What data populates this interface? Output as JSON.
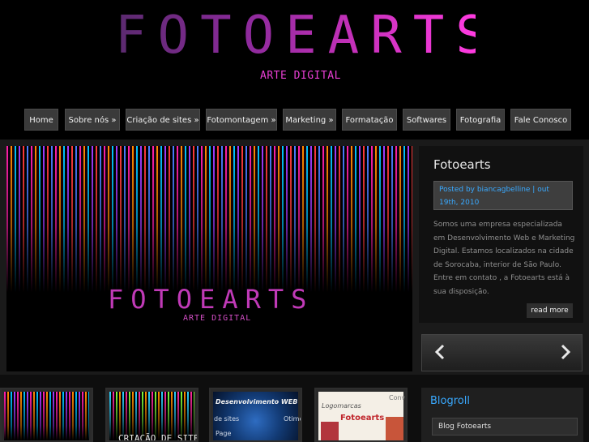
{
  "header": {
    "logo_text": "FOTOEARTS",
    "tagline": "ARTE DIGITAL"
  },
  "nav": {
    "items": [
      {
        "label": "Home"
      },
      {
        "label": "Sobre nós »"
      },
      {
        "label": "Criação de sites »"
      },
      {
        "label": "Fotomontagem »"
      },
      {
        "label": "Marketing »"
      },
      {
        "label": "Formatação"
      },
      {
        "label": "Softwares"
      },
      {
        "label": "Fotografia"
      },
      {
        "label": "Fale Conosco"
      }
    ]
  },
  "slider": {
    "logo_text": "FOTOEARTS",
    "sub_text": "ARTE DIGITAL",
    "prev_icon": "chevron-left",
    "next_icon": "chevron-right"
  },
  "post": {
    "title": "Fotoearts",
    "meta": "Posted by biancagbelline | out 19th, 2010",
    "body": "Somos uma empresa especializada em Desenvolvimento Web e Marketing Digital. Estamos localizados na cidade de Sorocaba, interior de São Paulo. Entre em contato ,  a Fotoearts está à sua disposição.",
    "read_more": "read more"
  },
  "thumbs": {
    "t2_text": "CRIAÇÃO DE SITES",
    "t3_text": "Desenvolvimento WEB",
    "t3_sub1": "de sites",
    "t3_sub2": "Page",
    "t3_sub3": "Otimo",
    "t4_text": "Logomarcas",
    "t4_logo": "Fotoearts",
    "t4_corner": "Conv"
  },
  "blogroll": {
    "title": "Blogroll",
    "items": [
      {
        "label": "Blog Fotoearts"
      }
    ]
  },
  "colors": {
    "accent_blue": "#39a9ff",
    "brand_pink": "#e93fd4"
  }
}
